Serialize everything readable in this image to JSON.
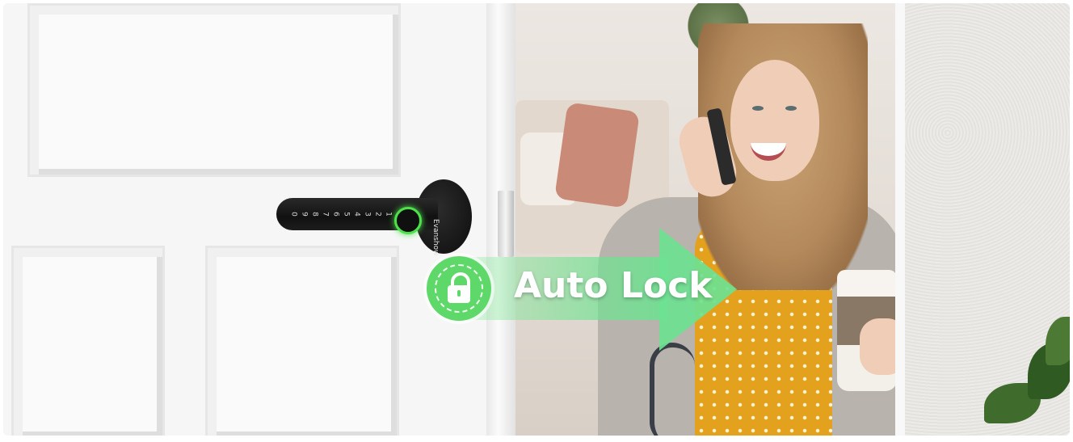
{
  "overlay": {
    "label": "Auto Lock",
    "icon": "padlock-icon",
    "accent_color": "#5fd86a"
  },
  "lock": {
    "brand": "Evanshow",
    "keys": [
      "1",
      "2",
      "3",
      "4",
      "5",
      "6",
      "7",
      "8",
      "9",
      "0"
    ],
    "fingerprint_ring_color": "#4ee24a",
    "finish_color": "#111111"
  }
}
